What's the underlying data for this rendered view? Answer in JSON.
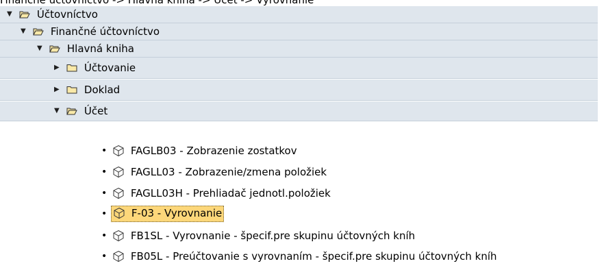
{
  "breadcrumb": "Finančné účtovníctvo -> Hlavná kniha -> Účet -> Vyrovnanie",
  "tree": [
    {
      "label": "Účtovníctvo",
      "expanded": true,
      "icon": "open-folder-icon"
    },
    {
      "label": "Finančné účtovníctvo",
      "expanded": true,
      "icon": "open-folder-icon"
    },
    {
      "label": "Hlavná kniha",
      "expanded": true,
      "icon": "open-folder-icon"
    },
    {
      "label": "Účtovanie",
      "expanded": false,
      "icon": "closed-folder-icon"
    },
    {
      "label": "Doklad",
      "expanded": false,
      "icon": "closed-folder-icon"
    },
    {
      "label": "Účet",
      "expanded": true,
      "icon": "open-folder-icon"
    }
  ],
  "transactions": [
    {
      "label": "FAGLB03 - Zobrazenie zostatkov",
      "icon": "transaction-cube-icon"
    },
    {
      "label": "FAGLL03 - Zobrazenie/zmena položiek",
      "icon": "transaction-cube-icon"
    },
    {
      "label": "FAGLL03H - Prehliadač jednotl.položiek",
      "icon": "transaction-cube-icon"
    },
    {
      "label": "F-03 - Vyrovnanie",
      "icon": "transaction-cube-icon",
      "selected": true
    },
    {
      "label": "FB1SL - Vyrovnanie - špecif.pre skupinu účtovných kníh",
      "icon": "transaction-cube-icon"
    },
    {
      "label": "FB05L - Preúčtovanie s vyrovnaním - špecif.pre skupinu účtovných kníh",
      "icon": "transaction-cube-icon"
    }
  ],
  "colors": {
    "folder_row_bg": "#dfe6ed",
    "selected_bg": "#fdd77a",
    "folder_fill": "#f9e9a8"
  }
}
